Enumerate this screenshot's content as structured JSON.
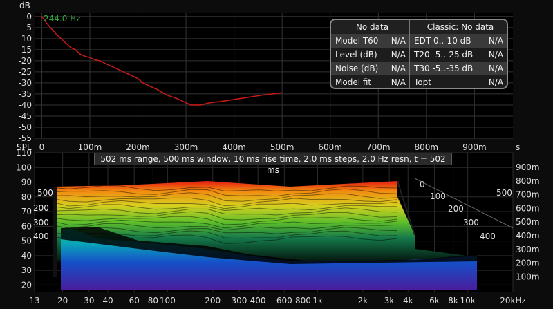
{
  "top_chart": {
    "yunit": "dB",
    "xunit": "s",
    "cursor_label": "244.0 Hz",
    "y_ticks": [
      "0",
      "-5",
      "-10",
      "-15",
      "-20",
      "-25",
      "-30",
      "-35",
      "-40",
      "-45",
      "-50",
      "-55"
    ],
    "x_ticks": [
      "0",
      "100m",
      "200m",
      "300m",
      "400m",
      "500m",
      "600m",
      "700m",
      "800m",
      "900m"
    ]
  },
  "chart_data": [
    {
      "type": "line",
      "title": "",
      "xlabel": "s",
      "ylabel": "dB",
      "xlim": [
        -0.015,
        0.98
      ],
      "ylim": [
        -55,
        1.5
      ],
      "grid": true,
      "series": [
        {
          "x": [
            0,
            0.01,
            0.02,
            0.03,
            0.04,
            0.05,
            0.06,
            0.07,
            0.08,
            0.09,
            0.1,
            0.11,
            0.12,
            0.14,
            0.16,
            0.18,
            0.2,
            0.21,
            0.22,
            0.24,
            0.26,
            0.28,
            0.3,
            0.31,
            0.33,
            0.35,
            0.37,
            0.4,
            0.43,
            0.46,
            0.5
          ],
          "y": [
            0,
            -3,
            -5.5,
            -8,
            -10,
            -12,
            -14,
            -15,
            -17,
            -18,
            -18.5,
            -19.5,
            -20,
            -22,
            -24,
            -26,
            -28,
            -30,
            -31,
            -33,
            -35.5,
            -37,
            -39,
            -40,
            -40,
            -39,
            -38.5,
            -37.5,
            -36.5,
            -35.5,
            -34.5
          ]
        }
      ]
    },
    {
      "type": "heatmap",
      "title": "",
      "xlabel": "Hz",
      "ylabel": "SPL",
      "xscale": "log",
      "xlim": [
        13,
        20000
      ],
      "ylim": [
        15,
        110
      ],
      "time_range_ms": [
        0,
        502
      ],
      "x_ticks": [
        "13",
        "20",
        "30",
        "40",
        "60",
        "80",
        "100",
        "200",
        "300",
        "400",
        "600",
        "800",
        "1k",
        "2k",
        "3k",
        "4k",
        "6k",
        "8k",
        "10k",
        "20kHz"
      ],
      "y_ticks": [
        "110",
        "100",
        "90",
        "80",
        "70",
        "60",
        "50",
        "40",
        "30",
        "20"
      ],
      "depth_ticks": [
        "0",
        "100",
        "200",
        "300",
        "400",
        "500"
      ],
      "time_axis_ticks": [
        "900m",
        "800m",
        "700m",
        "600m",
        "500m",
        "400m",
        "300m",
        "200m",
        "100m"
      ]
    }
  ],
  "stats_panel": {
    "left_header": "No data",
    "right_header": "Classic: No data",
    "rows": [
      {
        "left_label": "Model T60",
        "left_value": "N/A",
        "right_label": "EDT  0..-10 dB",
        "right_value": "N/A"
      },
      {
        "left_label": "Level (dB)",
        "left_value": "N/A",
        "right_label": "T20 -5..-25 dB",
        "right_value": "N/A"
      },
      {
        "left_label": "Noise (dB)",
        "left_value": "N/A",
        "right_label": "T30 -5..-35 dB",
        "right_value": "N/A"
      },
      {
        "left_label": "Model fit",
        "left_value": "N/A",
        "right_label": "Topt",
        "right_value": "N/A"
      }
    ]
  },
  "waterfall": {
    "yunit": "SPL",
    "info": "502 ms range, 500 ms window, 10 ms rise time, 2.0 ms steps,  2.0 Hz resn, t = 502 ms"
  },
  "colors": {
    "line": "#c21a1a",
    "cursor_label": "#2fae3a",
    "grid": "#3b3b3b"
  }
}
